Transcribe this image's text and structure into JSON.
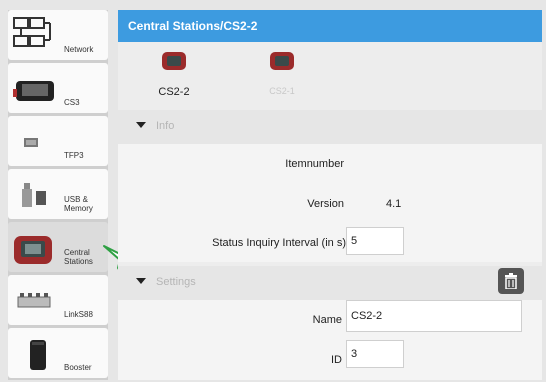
{
  "sidebar": {
    "items": [
      {
        "label": "Network",
        "icon": "network-icon"
      },
      {
        "label": "CS3",
        "icon": "cs3-icon"
      },
      {
        "label": "TFP3",
        "icon": "tfp3-icon"
      },
      {
        "label": "USB & Memory",
        "icon": "usb-memory-icon"
      },
      {
        "label": "Central Stations",
        "icon": "central-station-icon"
      },
      {
        "label": "LinkS88",
        "icon": "links88-icon"
      },
      {
        "label": "Booster",
        "icon": "booster-icon"
      }
    ]
  },
  "main": {
    "title": "Central Stations/CS2-2",
    "devices": [
      {
        "label": "CS2-2",
        "active": true
      },
      {
        "label": "CS2-1",
        "active": false
      }
    ],
    "info": {
      "section_label": "Info",
      "itemnumber_label": "Itemnumber",
      "version_label": "Version",
      "version_value": "4.1",
      "interval_label": "Status Inquiry Interval (in s)",
      "interval_value": "5"
    },
    "settings": {
      "section_label": "Settings",
      "name_label": "Name",
      "name_value": "CS2-2",
      "id_label": "ID",
      "id_value": "3"
    }
  },
  "colors": {
    "titlebar": "#3d9be0",
    "device_red": "#9b2b2b",
    "pointer_green": "#2ea043"
  }
}
